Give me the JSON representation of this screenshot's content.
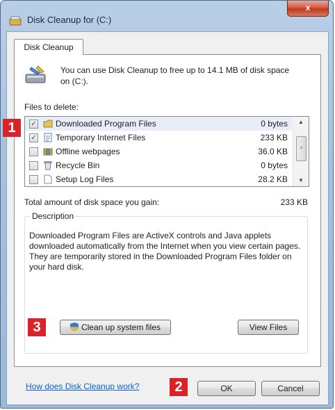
{
  "window": {
    "title": "Disk Cleanup for  (C:)",
    "close_label": "x"
  },
  "tab": {
    "label": "Disk Cleanup"
  },
  "intro": {
    "text": "You can use Disk Cleanup to free up to 14.1 MB of disk space on  (C:)."
  },
  "files": {
    "label": "Files to delete:",
    "rows": [
      {
        "name": "Downloaded Program Files",
        "size": "0 bytes",
        "checked": true,
        "icon": "folder-icon"
      },
      {
        "name": "Temporary Internet Files",
        "size": "233 KB",
        "checked": true,
        "icon": "document-icon"
      },
      {
        "name": "Offline webpages",
        "size": "36.0 KB",
        "checked": false,
        "icon": "web-folder-icon"
      },
      {
        "name": "Recycle Bin",
        "size": "0 bytes",
        "checked": false,
        "icon": "recycle-bin-icon"
      },
      {
        "name": "Setup Log Files",
        "size": "28.2 KB",
        "checked": false,
        "icon": "file-icon"
      }
    ]
  },
  "total": {
    "label": "Total amount of disk space you gain:",
    "value": "233 KB"
  },
  "description": {
    "label": "Description",
    "text": "Downloaded Program Files are ActiveX controls and Java applets downloaded automatically from the Internet when you view certain pages. They are temporarily stored in the Downloaded Program Files folder on your hard disk."
  },
  "buttons": {
    "cleanup_system": "Clean up system files",
    "view_files": "View Files",
    "ok": "OK",
    "cancel": "Cancel"
  },
  "help_link": "How does Disk Cleanup work?",
  "badges": {
    "one": "1",
    "two": "2",
    "three": "3"
  },
  "colors": {
    "badge": "#d9232a",
    "link": "#0a64c8",
    "selection": "#e7eef8"
  }
}
